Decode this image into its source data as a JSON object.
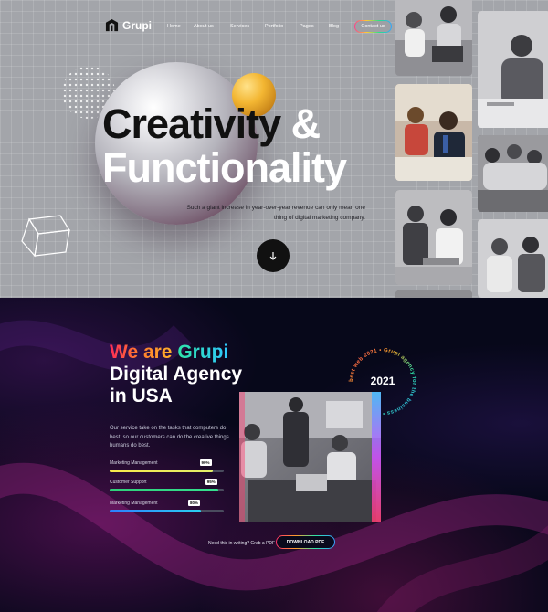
{
  "brand": {
    "name": "Grupi"
  },
  "nav": {
    "items": [
      "Home",
      "About us",
      "Services",
      "Portfolio",
      "Pages",
      "Blog"
    ],
    "active": "Home",
    "contact_label": "Contact us"
  },
  "hero": {
    "headline_word1": "Creativity",
    "headline_amp": "&",
    "headline_line2": "Functionality",
    "description": "Such a giant increase in year-over-year revenue can only mean one thing of digital marketing company.",
    "scroll_icon": "arrow-down-icon"
  },
  "agency": {
    "title_we_are": "We are",
    "title_brand": "Grupi",
    "title_line2": "Digital Agency",
    "title_line3": "in USA",
    "description": "Our service take on the tasks that computers do best, so our customers can do the creative things humans do best.",
    "skills": [
      {
        "label": "Marketing Management",
        "percent": 90,
        "percent_label": "90%",
        "color": "#f7e94a",
        "color2": "#e4f06a"
      },
      {
        "label": "Customer Support",
        "percent": 95,
        "percent_label": "95%",
        "color": "#2fd07a",
        "color2": "#36e08f"
      },
      {
        "label": "Marketing Management",
        "percent": 80,
        "percent_label": "80%",
        "color": "#2c7fff",
        "color2": "#2ad0f0"
      }
    ],
    "badge": {
      "year": "2021",
      "ring_text": "best web 2021 • Grupi agency for the business • "
    },
    "pdf_prompt": "Need this in writing? Grab a PDF",
    "pdf_button": "DOWNLOAD PDF"
  },
  "colors": {
    "hero_bg": "#a3a5aa",
    "dark_bg": "#07081a",
    "accent_pink": "#ff2b57",
    "accent_orange": "#ffb12a",
    "accent_green": "#2ee5a8",
    "accent_blue": "#2fc8ff"
  }
}
